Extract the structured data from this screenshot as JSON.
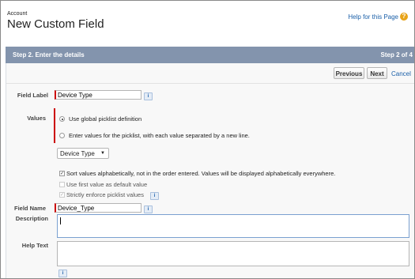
{
  "header": {
    "object_label": "Account",
    "page_title": "New Custom Field",
    "help_link": "Help for this Page"
  },
  "step": {
    "title": "Step 2. Enter the details",
    "count": "Step 2 of 4"
  },
  "nav": {
    "previous_label": "Previous",
    "next_label": "Next",
    "cancel_label": "Cancel"
  },
  "form": {
    "field_label": {
      "label": "Field Label",
      "value": "Device Type"
    },
    "values": {
      "label": "Values",
      "option_global": "Use global picklist definition",
      "option_manual": "Enter values for the picklist, with each value separated by a new line.",
      "selected_option": "global",
      "global_picklist": "Device Type"
    },
    "checkboxes": {
      "sort_label": "Sort values alphabetically, not in the order entered. Values will be displayed alphabetically everywhere.",
      "default_label": "Use first value as default value",
      "strict_label": "Strictly enforce picklist values"
    },
    "field_name": {
      "label": "Field Name",
      "value": "Device_Type"
    },
    "description": {
      "label": "Description",
      "value": ""
    },
    "help_text": {
      "label": "Help Text",
      "value": ""
    }
  },
  "icons": {
    "help": "?",
    "info": "i",
    "caret": "▼",
    "check": "✓"
  },
  "colors": {
    "step_bar": "#8394ad",
    "link": "#1a5fa8",
    "required": "#cc0000",
    "help_icon": "#e8a317"
  }
}
